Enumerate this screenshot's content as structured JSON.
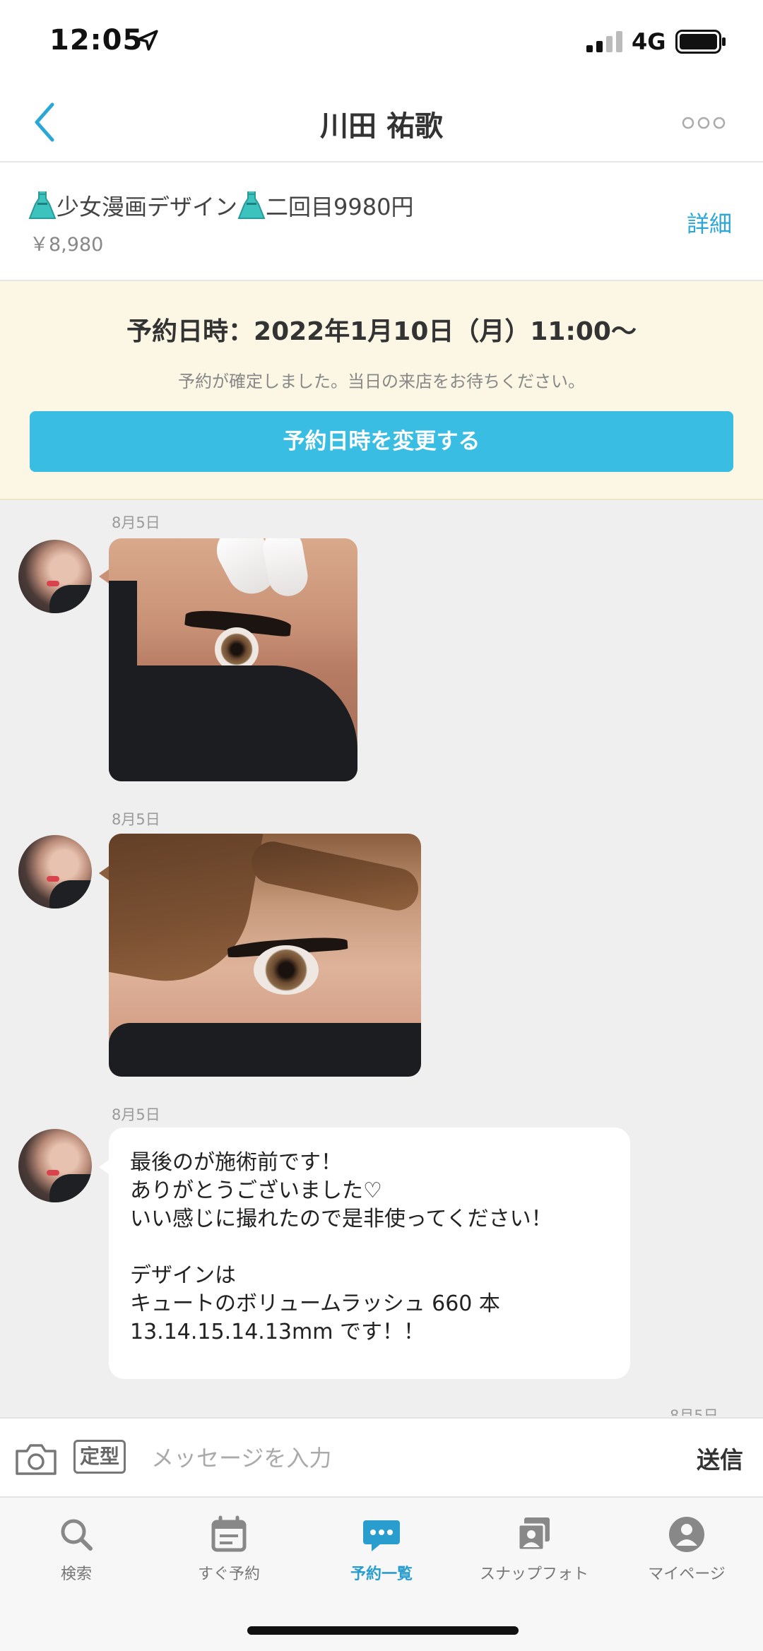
{
  "status_bar": {
    "time": "12:05",
    "network": "4G"
  },
  "nav": {
    "title": "川田 祐歌"
  },
  "menu": {
    "name": "少女漫画デザイン",
    "name_suffix": "二回目9980円",
    "price": "￥8,980",
    "detail_label": "詳細"
  },
  "reservation": {
    "datetime": "予約日時：2022年1月10日（月）11:00〜",
    "note": "予約が確定しました。当日の来店をお待ちください。",
    "change_button": "予約日時を変更する"
  },
  "chat": {
    "messages": [
      {
        "date": "8月5日",
        "type": "image"
      },
      {
        "date": "8月5日",
        "type": "image"
      },
      {
        "date": "8月5日",
        "type": "text",
        "lines": [
          "最後のが施術前です！",
          "ありがとうございました♡",
          "いい感じに撮れたので是非使ってください！",
          "",
          "デザインは",
          "キュートのボリュームラッシュ 660 本",
          "13.14.15.14.13mm です！！"
        ]
      }
    ],
    "next_date_partial": "8月5日"
  },
  "input_bar": {
    "template_label": "定型",
    "placeholder": "メッセージを入力",
    "send_label": "送信"
  },
  "tabs": [
    {
      "label": "検索",
      "icon": "search-icon"
    },
    {
      "label": "すぐ予約",
      "icon": "calendar-icon"
    },
    {
      "label": "予約一覧",
      "icon": "chat-bubble-icon",
      "active": true
    },
    {
      "label": "スナップフォト",
      "icon": "photos-icon"
    },
    {
      "label": "マイページ",
      "icon": "person-icon"
    }
  ],
  "colors": {
    "accent": "#39bde3",
    "link": "#2aa7d6",
    "reserve_bg": "#fbf7e4",
    "chat_bg": "#efefef"
  }
}
